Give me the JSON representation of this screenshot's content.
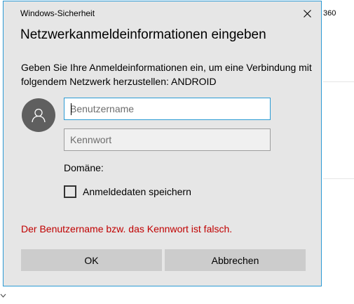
{
  "background": {
    "partial_text": "360"
  },
  "dialog": {
    "window_title": "Windows-Sicherheit",
    "heading": "Netzwerkanmeldeinformationen eingeben",
    "description": "Geben Sie Ihre Anmeldeinformationen ein, um eine Verbindung mit folgendem Netzwerk herzustellen: ANDROID",
    "username": {
      "value": "",
      "placeholder": "Benutzername"
    },
    "password": {
      "value": "",
      "placeholder": "Kennwort"
    },
    "domain_label": "Domäne:",
    "remember": {
      "label": "Anmeldedaten speichern",
      "checked": false
    },
    "error_message": "Der Benutzername bzw. das Kennwort ist falsch.",
    "ok_label": "OK",
    "cancel_label": "Abbrechen"
  },
  "colors": {
    "accent": "#2b9bd4",
    "dialog_bg": "#e6e6e6",
    "error": "#c00000",
    "button_bg": "#cccccc",
    "avatar_bg": "#5f5f5f"
  },
  "icons": {
    "close": "close-icon",
    "avatar": "user-icon",
    "dropdown": "chevron-down-icon"
  }
}
